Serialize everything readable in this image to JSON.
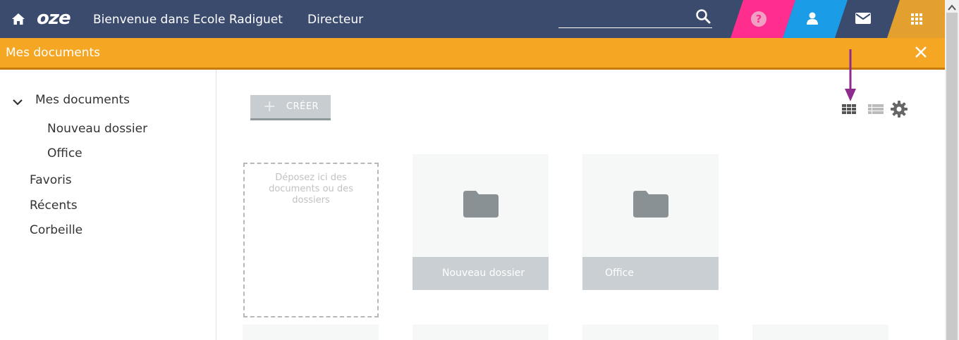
{
  "topbar": {
    "logo": "oze",
    "welcome": "Bienvenue dans Ecole Radiguet",
    "role": "Directeur",
    "search_value": "",
    "help_glyph": "?",
    "icons": [
      "home-icon",
      "search-icon",
      "help-icon",
      "user-icon",
      "mail-icon",
      "apps-icon"
    ]
  },
  "section": {
    "title": "Mes documents",
    "close": "×"
  },
  "sidebar": {
    "root": "Mes documents",
    "children": [
      "Nouveau dossier",
      "Office"
    ],
    "items": [
      "Favoris",
      "Récents",
      "Corbeille"
    ]
  },
  "toolbar": {
    "create_plus": "+",
    "create_label": "CRÉER",
    "icons": [
      "grid-view-icon",
      "list-view-icon",
      "settings-icon"
    ]
  },
  "main": {
    "dropzone_text": "Déposez ici des documents ou des dossiers",
    "folders": [
      "Nouveau dossier",
      "Office"
    ]
  },
  "colors": {
    "topbar": "#3b4b6e",
    "orange": "#f5a623",
    "pink": "#ff2d8d",
    "blue": "#1a9de6",
    "gold": "#e3a02e",
    "arrow": "#8e2c8e"
  }
}
